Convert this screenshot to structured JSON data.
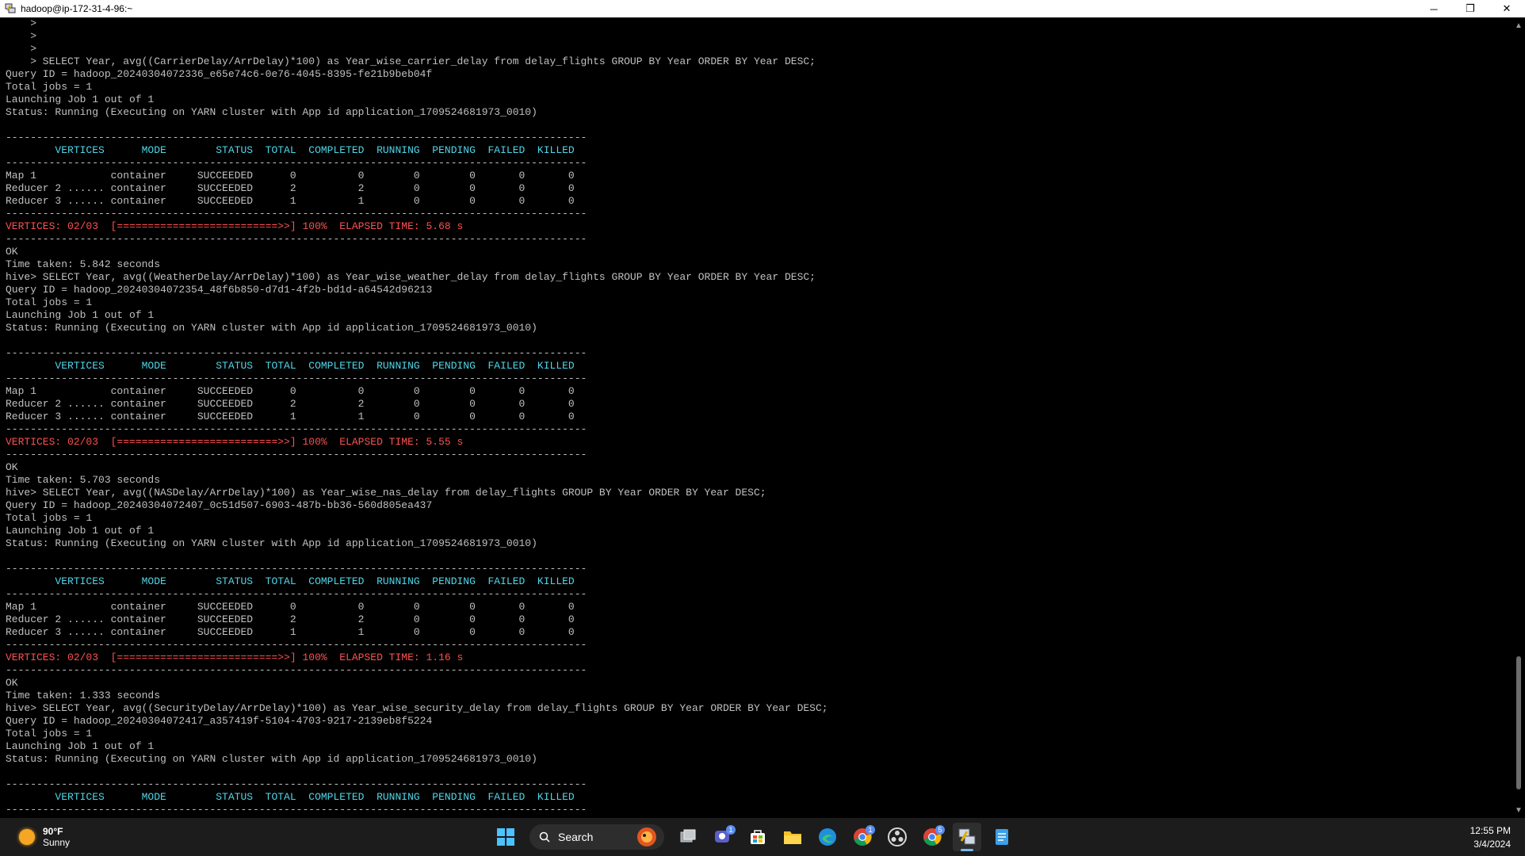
{
  "window": {
    "title": "hadoop@ip-172-31-4-96:~"
  },
  "window_controls": {
    "minimize": "─",
    "restore": "❐",
    "close": "✕"
  },
  "terminal_lines": [
    {
      "t": "    >",
      "c": ""
    },
    {
      "t": "    >",
      "c": ""
    },
    {
      "t": "    >",
      "c": ""
    },
    {
      "t": "    > SELECT Year, avg((CarrierDelay/ArrDelay)*100) as Year_wise_carrier_delay from delay_flights GROUP BY Year ORDER BY Year DESC;",
      "c": ""
    },
    {
      "t": "Query ID = hadoop_20240304072336_e65e74c6-0e76-4045-8395-fe21b9beb04f",
      "c": ""
    },
    {
      "t": "Total jobs = 1",
      "c": ""
    },
    {
      "t": "Launching Job 1 out of 1",
      "c": ""
    },
    {
      "t": "Status: Running (Executing on YARN cluster with App id application_1709524681973_0010)",
      "c": ""
    },
    {
      "t": "",
      "c": ""
    },
    {
      "t": "----------------------------------------------------------------------------------------------",
      "c": ""
    },
    {
      "t": "        VERTICES      MODE        STATUS  TOTAL  COMPLETED  RUNNING  PENDING  FAILED  KILLED",
      "c": "cyan"
    },
    {
      "t": "----------------------------------------------------------------------------------------------",
      "c": ""
    },
    {
      "t": "Map 1            container     SUCCEEDED      0          0        0        0       0       0",
      "c": ""
    },
    {
      "t": "Reducer 2 ...... container     SUCCEEDED      2          2        0        0       0       0",
      "c": ""
    },
    {
      "t": "Reducer 3 ...... container     SUCCEEDED      1          1        0        0       0       0",
      "c": ""
    },
    {
      "t": "----------------------------------------------------------------------------------------------",
      "c": ""
    },
    {
      "t": "VERTICES: 02/03  [==========================>>] 100%  ELAPSED TIME: 5.68 s",
      "c": "red"
    },
    {
      "t": "----------------------------------------------------------------------------------------------",
      "c": ""
    },
    {
      "t": "OK",
      "c": ""
    },
    {
      "t": "Time taken: 5.842 seconds",
      "c": ""
    },
    {
      "t": "hive> SELECT Year, avg((WeatherDelay/ArrDelay)*100) as Year_wise_weather_delay from delay_flights GROUP BY Year ORDER BY Year DESC;",
      "c": ""
    },
    {
      "t": "Query ID = hadoop_20240304072354_48f6b850-d7d1-4f2b-bd1d-a64542d96213",
      "c": ""
    },
    {
      "t": "Total jobs = 1",
      "c": ""
    },
    {
      "t": "Launching Job 1 out of 1",
      "c": ""
    },
    {
      "t": "Status: Running (Executing on YARN cluster with App id application_1709524681973_0010)",
      "c": ""
    },
    {
      "t": "",
      "c": ""
    },
    {
      "t": "----------------------------------------------------------------------------------------------",
      "c": ""
    },
    {
      "t": "        VERTICES      MODE        STATUS  TOTAL  COMPLETED  RUNNING  PENDING  FAILED  KILLED",
      "c": "cyan"
    },
    {
      "t": "----------------------------------------------------------------------------------------------",
      "c": ""
    },
    {
      "t": "Map 1            container     SUCCEEDED      0          0        0        0       0       0",
      "c": ""
    },
    {
      "t": "Reducer 2 ...... container     SUCCEEDED      2          2        0        0       0       0",
      "c": ""
    },
    {
      "t": "Reducer 3 ...... container     SUCCEEDED      1          1        0        0       0       0",
      "c": ""
    },
    {
      "t": "----------------------------------------------------------------------------------------------",
      "c": ""
    },
    {
      "t": "VERTICES: 02/03  [==========================>>] 100%  ELAPSED TIME: 5.55 s",
      "c": "red"
    },
    {
      "t": "----------------------------------------------------------------------------------------------",
      "c": ""
    },
    {
      "t": "OK",
      "c": ""
    },
    {
      "t": "Time taken: 5.703 seconds",
      "c": ""
    },
    {
      "t": "hive> SELECT Year, avg((NASDelay/ArrDelay)*100) as Year_wise_nas_delay from delay_flights GROUP BY Year ORDER BY Year DESC;",
      "c": ""
    },
    {
      "t": "Query ID = hadoop_20240304072407_0c51d507-6903-487b-bb36-560d805ea437",
      "c": ""
    },
    {
      "t": "Total jobs = 1",
      "c": ""
    },
    {
      "t": "Launching Job 1 out of 1",
      "c": ""
    },
    {
      "t": "Status: Running (Executing on YARN cluster with App id application_1709524681973_0010)",
      "c": ""
    },
    {
      "t": "",
      "c": ""
    },
    {
      "t": "----------------------------------------------------------------------------------------------",
      "c": ""
    },
    {
      "t": "        VERTICES      MODE        STATUS  TOTAL  COMPLETED  RUNNING  PENDING  FAILED  KILLED",
      "c": "cyan"
    },
    {
      "t": "----------------------------------------------------------------------------------------------",
      "c": ""
    },
    {
      "t": "Map 1            container     SUCCEEDED      0          0        0        0       0       0",
      "c": ""
    },
    {
      "t": "Reducer 2 ...... container     SUCCEEDED      2          2        0        0       0       0",
      "c": ""
    },
    {
      "t": "Reducer 3 ...... container     SUCCEEDED      1          1        0        0       0       0",
      "c": ""
    },
    {
      "t": "----------------------------------------------------------------------------------------------",
      "c": ""
    },
    {
      "t": "VERTICES: 02/03  [==========================>>] 100%  ELAPSED TIME: 1.16 s",
      "c": "red"
    },
    {
      "t": "----------------------------------------------------------------------------------------------",
      "c": ""
    },
    {
      "t": "OK",
      "c": ""
    },
    {
      "t": "Time taken: 1.333 seconds",
      "c": ""
    },
    {
      "t": "hive> SELECT Year, avg((SecurityDelay/ArrDelay)*100) as Year_wise_security_delay from delay_flights GROUP BY Year ORDER BY Year DESC;",
      "c": ""
    },
    {
      "t": "Query ID = hadoop_20240304072417_a357419f-5104-4703-9217-2139eb8f5224",
      "c": ""
    },
    {
      "t": "Total jobs = 1",
      "c": ""
    },
    {
      "t": "Launching Job 1 out of 1",
      "c": ""
    },
    {
      "t": "Status: Running (Executing on YARN cluster with App id application_1709524681973_0010)",
      "c": ""
    },
    {
      "t": "",
      "c": ""
    },
    {
      "t": "----------------------------------------------------------------------------------------------",
      "c": ""
    },
    {
      "t": "        VERTICES      MODE        STATUS  TOTAL  COMPLETED  RUNNING  PENDING  FAILED  KILLED",
      "c": "cyan"
    },
    {
      "t": "----------------------------------------------------------------------------------------------",
      "c": ""
    }
  ],
  "taskbar": {
    "weather": {
      "temp": "90°F",
      "condition": "Sunny"
    },
    "search_label": "Search",
    "apps": [
      {
        "name": "start-icon"
      },
      {
        "name": "search"
      },
      {
        "name": "widget-icon"
      },
      {
        "name": "task-view-icon"
      },
      {
        "name": "teams-icon",
        "badge": "1"
      },
      {
        "name": "store-icon"
      },
      {
        "name": "file-explorer-icon"
      },
      {
        "name": "edge-icon"
      },
      {
        "name": "chrome-icon",
        "badge": "1"
      },
      {
        "name": "obs-icon"
      },
      {
        "name": "chrome-2-icon",
        "badge": "5"
      },
      {
        "name": "putty-icon",
        "active": true
      },
      {
        "name": "notepad-icon"
      }
    ],
    "clock": {
      "time": "12:55 PM",
      "date": "3/4/2024"
    }
  },
  "colors": {
    "terminal_text": "#c0c0c0",
    "cyan": "#4fd6e8",
    "red": "#ff5050",
    "taskbar": "#1c1c1c"
  }
}
